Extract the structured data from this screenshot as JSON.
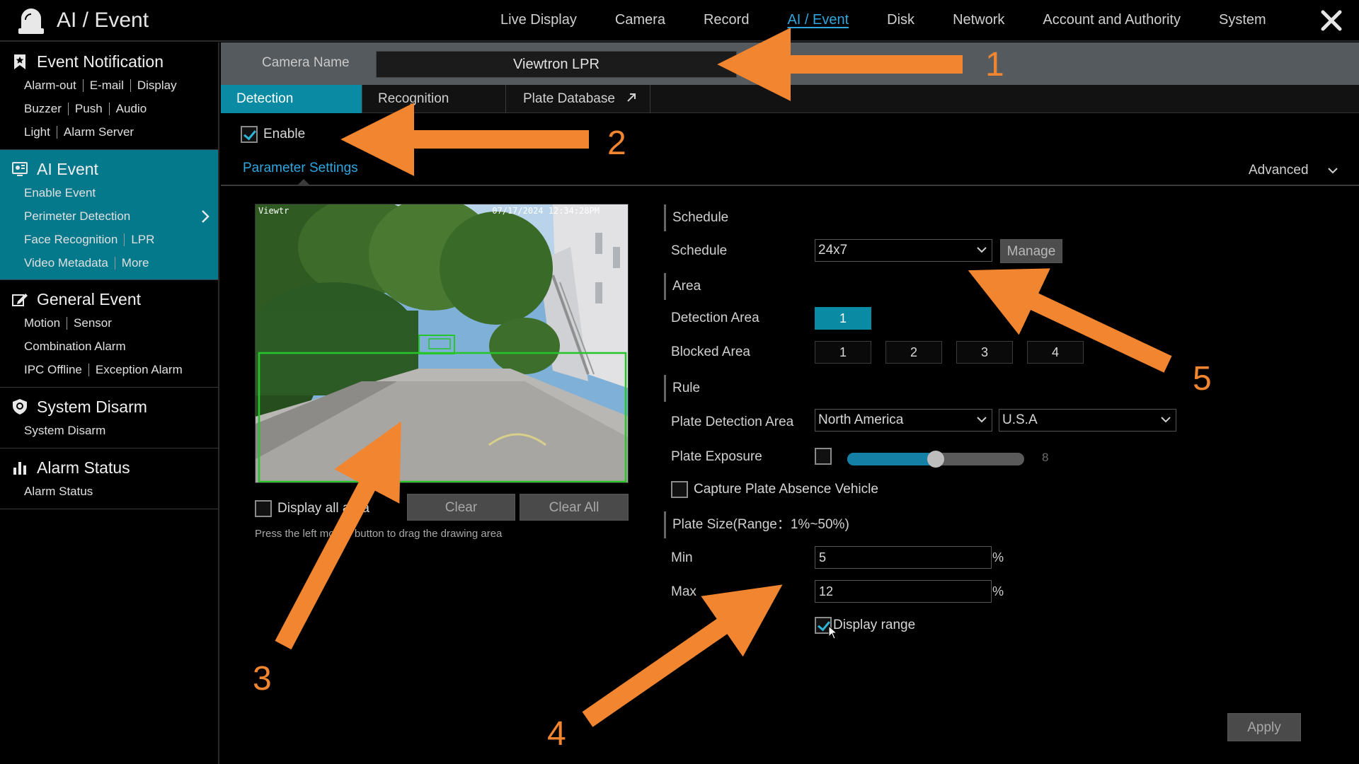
{
  "app": {
    "title": "AI / Event"
  },
  "topnav": [
    "Live Display",
    "Camera",
    "Record",
    "AI / Event",
    "Disk",
    "Network",
    "Account and Authority",
    "System"
  ],
  "topnav_active": "AI / Event",
  "sidebar": {
    "event_notification": {
      "title": "Event Notification",
      "rows": [
        [
          "Alarm-out",
          "E-mail",
          "Display"
        ],
        [
          "Buzzer",
          "Push",
          "Audio"
        ],
        [
          "Light",
          "Alarm Server"
        ]
      ]
    },
    "ai_event": {
      "title": "AI Event",
      "rows": [
        [
          "Enable Event"
        ],
        [
          "Perimeter Detection"
        ],
        [
          "Face Recognition",
          "LPR"
        ],
        [
          "Video Metadata",
          "More"
        ]
      ]
    },
    "general_event": {
      "title": "General Event",
      "rows": [
        [
          "Motion",
          "Sensor"
        ],
        [
          "Combination Alarm"
        ],
        [
          "IPC Offline",
          "Exception Alarm"
        ]
      ]
    },
    "system_disarm": {
      "title": "System Disarm",
      "rows": [
        [
          "System Disarm"
        ]
      ]
    },
    "alarm_status": {
      "title": "Alarm Status",
      "rows": [
        [
          "Alarm Status"
        ]
      ]
    }
  },
  "camera": {
    "label": "Camera Name",
    "value": "Viewtron LPR"
  },
  "tabs": {
    "detection": "Detection",
    "recognition": "Recognition",
    "plate_database": "Plate Database"
  },
  "enable": {
    "label": "Enable",
    "checked": true
  },
  "param_settings": "Parameter Settings",
  "advanced": "Advanced",
  "video": {
    "osd_name": "Viewtr",
    "osd_time": "07/17/2024 12:34:28PM"
  },
  "display_all_area": {
    "label": "Display all area",
    "checked": false
  },
  "buttons": {
    "clear": "Clear",
    "clear_all": "Clear All",
    "manage": "Manage",
    "apply": "Apply"
  },
  "hint": "Press the left mouse button to drag the drawing area",
  "schedule": {
    "group": "Schedule",
    "label": "Schedule",
    "value": "24x7"
  },
  "area": {
    "group": "Area",
    "detection_label": "Detection Area",
    "detection_items": [
      "1"
    ],
    "blocked_label": "Blocked Area",
    "blocked_items": [
      "1",
      "2",
      "3",
      "4"
    ]
  },
  "rule": {
    "group": "Rule",
    "plate_detection_area_label": "Plate Detection Area",
    "region": "North America",
    "country": "U.S.A",
    "plate_exposure_label": "Plate Exposure",
    "plate_exposure_enabled": false,
    "plate_exposure_value": "8",
    "plate_exposure_level": 0.5,
    "capture_absence_label": "Capture Plate Absence Vehicle",
    "capture_absence_checked": false
  },
  "plate_size": {
    "group": "Plate Size(Range：1%~50%)",
    "min_label": "Min",
    "min_value": "5",
    "max_label": "Max",
    "max_value": "12",
    "unit": "%",
    "display_range_label": "Display range",
    "display_range_checked": true
  },
  "annotations": [
    "1",
    "2",
    "3",
    "4",
    "5"
  ],
  "colors": {
    "accent": "#0a8aa3",
    "link": "#2fa6de",
    "annotation": "#f2852f",
    "detection_box": "#27c42a"
  }
}
